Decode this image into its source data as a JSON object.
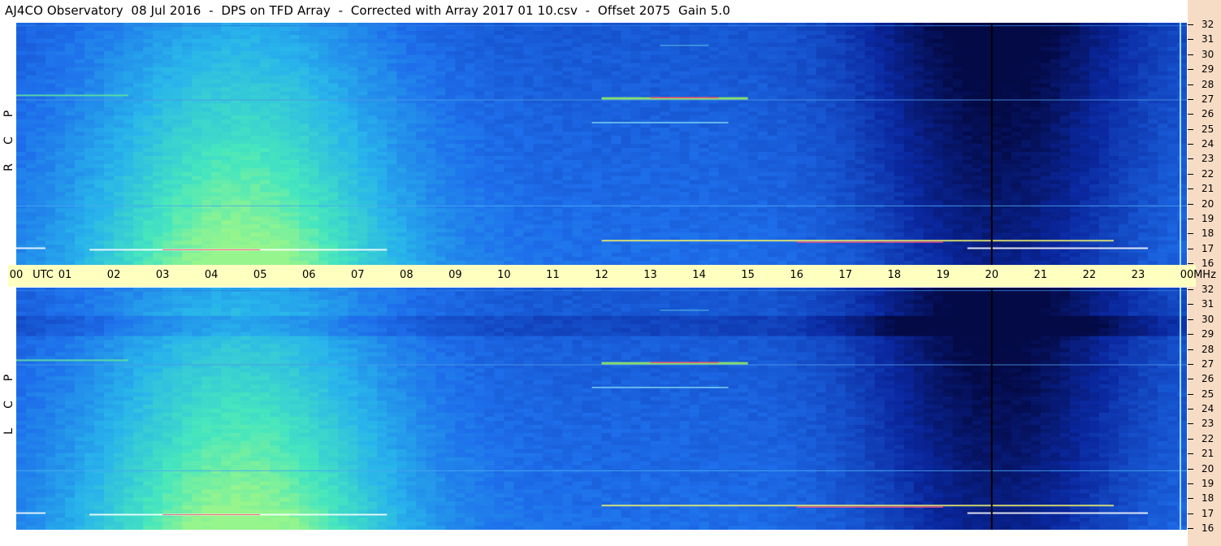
{
  "title": "AJ4CO Observatory  08 Jul 2016  -  DPS on TFD Array  -  Corrected with Array 2017 01 10.csv  -  Offset 2075  Gain 5.0",
  "time_axis": {
    "labels": [
      "00",
      "01",
      "02",
      "03",
      "04",
      "05",
      "06",
      "07",
      "08",
      "09",
      "10",
      "11",
      "12",
      "13",
      "14",
      "15",
      "16",
      "17",
      "18",
      "19",
      "20",
      "21",
      "22",
      "23",
      "00"
    ],
    "utc_label": "UTC",
    "mhz_label": "MHz"
  },
  "panels": [
    {
      "id": "rcp",
      "polarization_letters": [
        "R",
        "C",
        "P"
      ]
    },
    {
      "id": "lcp",
      "polarization_letters": [
        "L",
        "C",
        "P"
      ]
    }
  ],
  "chart_data": {
    "type": "heatmap",
    "title": "AJ4CO Observatory  08 Jul 2016  -  DPS on TFD Array  -  Corrected with Array 2017 01 10.csv  -  Offset 2075  Gain 5.0",
    "xlabel": "UTC",
    "ylabel": "MHz",
    "x_ticks": [
      "00",
      "01",
      "02",
      "03",
      "04",
      "05",
      "06",
      "07",
      "08",
      "09",
      "10",
      "11",
      "12",
      "13",
      "14",
      "15",
      "16",
      "17",
      "18",
      "19",
      "20",
      "21",
      "22",
      "23",
      "00"
    ],
    "y_ticks": [
      32,
      31,
      30,
      29,
      28,
      27,
      26,
      25,
      24,
      23,
      22,
      21,
      20,
      19,
      18,
      17,
      16
    ],
    "ylim": [
      16,
      32
    ],
    "xlim_hours": [
      0,
      24
    ],
    "panels": [
      "RCP",
      "LCP"
    ],
    "marker_hour": 20,
    "colors": {
      "low": "#06106a",
      "mid": "#2a70e8",
      "high": "#5ef0b0",
      "peak": "#ff3060"
    }
  }
}
